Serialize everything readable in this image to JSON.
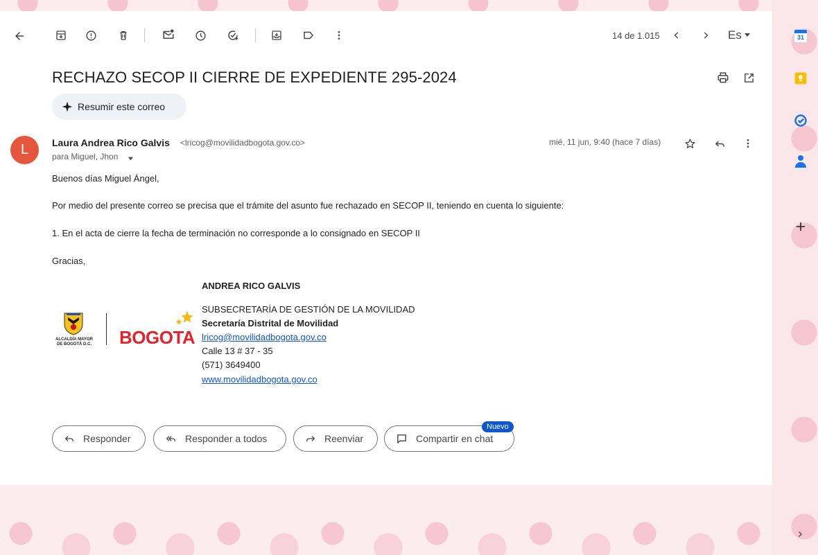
{
  "toolbar": {
    "counter": "14 de 1.015",
    "input_tool": "Es"
  },
  "email": {
    "subject": "RECHAZO SECOP II CIERRE DE EXPEDIENTE 295-2024",
    "summarize_label": "Resumir este correo",
    "sender_initial": "L",
    "sender_name": "Laura Andrea Rico Galvis",
    "sender_email": "<lricog@movilidadbogota.gov.co>",
    "recipients": "para Miguel, Jhon",
    "date": "mié, 11 jun, 9:40 (hace 7 días)",
    "greeting": "Buenos días Miguel Ángel,",
    "paragraph": "Por medio del presente correo se precisa que el trámite del asunto fue rechazado en SECOP II, teniendo en cuenta lo siguiente:",
    "item1": "1. En el acta de cierre la fecha de terminación no corresponde a lo consignado en SECOP II",
    "closing": "Gracias,"
  },
  "signature": {
    "name": "ANDREA RICO GALVIS",
    "department": "SUBSECRETARÍA DE GESTIÓN DE LA MOVILIDAD",
    "office": "Secretaría Distrital de Movilidad",
    "email": "lricog@movilidadbogota.gov.co",
    "address": "Calle 13 # 37 - 35",
    "phone": "(571) 3649400",
    "website": "www.movilidadbogota.gov.co",
    "logo_alcaldia_line1": "ALCALDÍA MAYOR",
    "logo_alcaldia_line2": "DE BOGOTÁ D.C.",
    "logo_bogota": "BOGOTA"
  },
  "actions": {
    "reply": "Responder",
    "reply_all": "Responder a todos",
    "forward": "Reenviar",
    "share_chat": "Compartir en chat",
    "new_badge": "Nuevo"
  },
  "side_panel": {
    "calendar_day": "31"
  },
  "colors": {
    "avatar": "#e4573d",
    "link": "#1155cc",
    "badge": "#0b57d0",
    "bogota_red": "#e3232b",
    "star_yellow": "#f6b90f"
  }
}
